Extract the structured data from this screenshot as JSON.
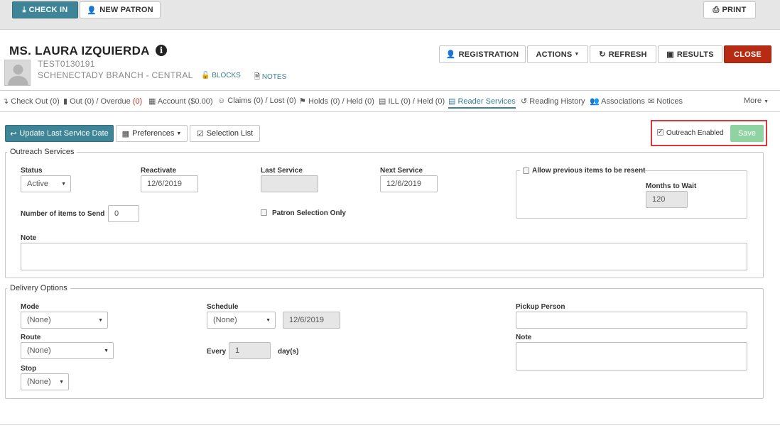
{
  "toolbar": {
    "checkin_label": "CHECK IN",
    "new_patron_label": "NEW PATRON",
    "print_label": "PRINT"
  },
  "patron": {
    "name": "MS. LAURA IZQUIERDA",
    "barcode": "TEST0130191",
    "branch": "SCHENECTADY BRANCH - CENTRAL",
    "blocks_label": "BLOCKS",
    "notes_label": "NOTES"
  },
  "actions": {
    "registration": "REGISTRATION",
    "actions": "ACTIONS",
    "refresh": "REFRESH",
    "results": "RESULTS",
    "close": "CLOSE"
  },
  "tabs": {
    "checkout": "Check Out (0)",
    "out_prefix": "Out (0) / Overdue ",
    "overdue_count": "(0)",
    "account": "Account ($0.00)",
    "claims": "Claims (0) / Lost (0)",
    "holds": "Holds (0) / Held (0)",
    "ill": "ILL (0) / Held (0)",
    "reader_services": "Reader Services",
    "reading_history": "Reading History",
    "associations": "Associations",
    "notices": "Notices",
    "more": "More"
  },
  "subtoolbar": {
    "update_label": "Update Last Service Date",
    "preferences_label": "Preferences",
    "selection_list_label": "Selection List",
    "outreach_enabled_label": "Outreach Enabled",
    "outreach_enabled_checked": true,
    "save_label": "Save"
  },
  "outreach": {
    "legend": "Outreach Services",
    "status_label": "Status",
    "status_value": "Active",
    "reactivate_label": "Reactivate",
    "reactivate_value": "12/6/2019",
    "last_service_label": "Last Service",
    "last_service_value": "",
    "next_service_label": "Next Service",
    "next_service_value": "12/6/2019",
    "allow_resent_label": "Allow previous items to be resent",
    "months_to_wait_label": "Months to Wait",
    "months_to_wait_value": "120",
    "items_to_send_label": "Number of items to Send",
    "items_to_send_value": "0",
    "patron_selection_label": "Patron Selection Only",
    "note_label": "Note",
    "note_value": ""
  },
  "delivery": {
    "legend": "Delivery Options",
    "mode_label": "Mode",
    "mode_value": "(None)",
    "route_label": "Route",
    "route_value": "(None)",
    "stop_label": "Stop",
    "stop_value": "(None)",
    "schedule_label": "Schedule",
    "schedule_value": "(None)",
    "schedule_date": "12/6/2019",
    "every_label": "Every",
    "every_value": "1",
    "days_label": "day(s)",
    "pickup_label": "Pickup Person",
    "pickup_value": "",
    "note_label": "Note",
    "note_value": ""
  }
}
